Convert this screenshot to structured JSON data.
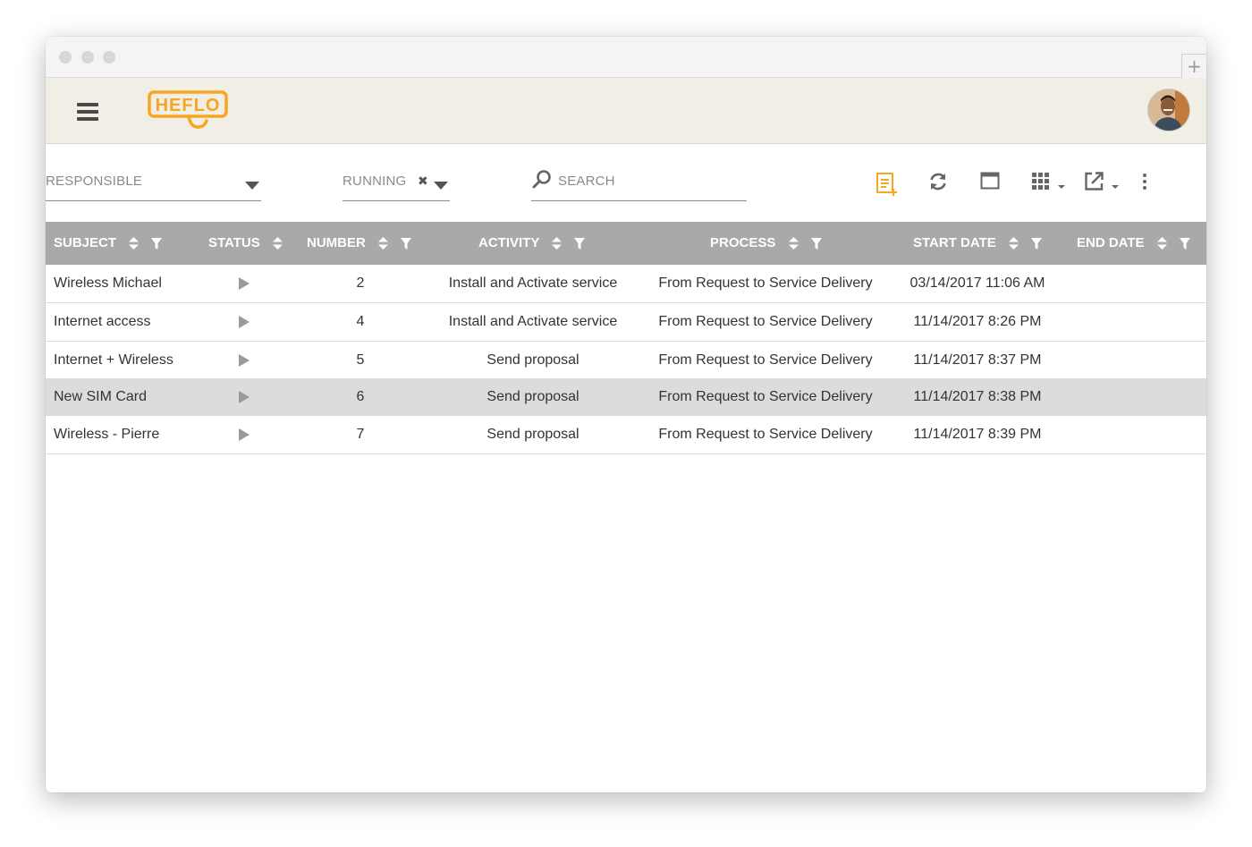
{
  "app": {
    "logo_text": "HEFLO",
    "new_tab_label": "+"
  },
  "filters": {
    "responsible_label": "RESPONSIBLE",
    "status_label": "RUNNING",
    "search_placeholder": "SEARCH"
  },
  "toolbar_icons": [
    "new-document-icon",
    "refresh-icon",
    "window-icon",
    "grid-icon",
    "export-icon",
    "more-vertical-icon"
  ],
  "colors": {
    "accent": "#f5a623",
    "header_bg": "#f1eee6",
    "table_header_bg": "#a9a9a9",
    "selected_row_bg": "#dcdcdc"
  },
  "table": {
    "columns": [
      "SUBJECT",
      "STATUS",
      "NUMBER",
      "ACTIVITY",
      "PROCESS",
      "START DATE",
      "END DATE"
    ],
    "rows": [
      {
        "subject": "Wireless Michael",
        "number": "2",
        "activity": "Install and Activate service",
        "process": "From Request to Service Delivery",
        "start_date": "03/14/2017 11:06 AM",
        "end_date": ""
      },
      {
        "subject": "Internet access",
        "number": "4",
        "activity": "Install and Activate service",
        "process": "From Request to Service Delivery",
        "start_date": "11/14/2017 8:26 PM",
        "end_date": ""
      },
      {
        "subject": "Internet + Wireless",
        "number": "5",
        "activity": "Send proposal",
        "process": "From Request to Service Delivery",
        "start_date": "11/14/2017 8:37 PM",
        "end_date": ""
      },
      {
        "subject": "New SIM Card",
        "number": "6",
        "activity": "Send proposal",
        "process": "From Request to Service Delivery",
        "start_date": "11/14/2017 8:38 PM",
        "end_date": ""
      },
      {
        "subject": "Wireless - Pierre",
        "number": "7",
        "activity": "Send proposal",
        "process": "From Request to Service Delivery",
        "start_date": "11/14/2017 8:39 PM",
        "end_date": ""
      }
    ]
  }
}
